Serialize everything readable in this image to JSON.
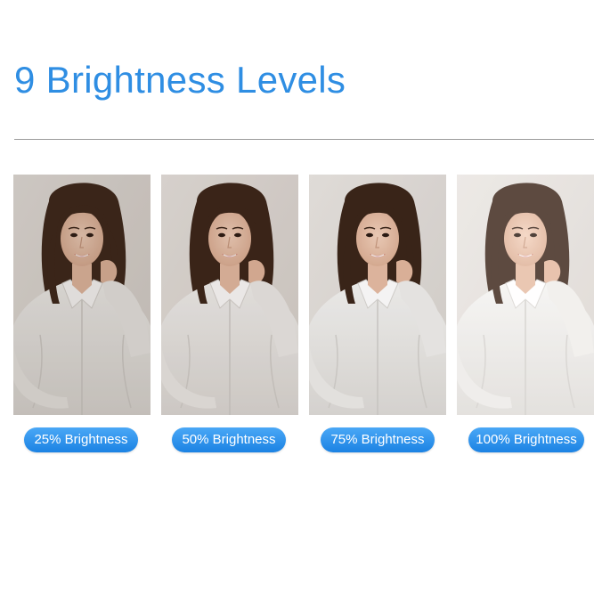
{
  "header": {
    "title": "9 Brightness Levels",
    "title_color": "#2f8ee3"
  },
  "panels": [
    {
      "label": "25% Brightness",
      "brightness": 0.25
    },
    {
      "label": "50% Brightness",
      "brightness": 0.5
    },
    {
      "label": "75% Brightness",
      "brightness": 0.75
    },
    {
      "label": "100% Brightness",
      "brightness": 1.0
    }
  ],
  "colors": {
    "pill_top": "#4aa8f6",
    "pill_bottom": "#1b82e3",
    "divider": "#9a9a9a"
  }
}
